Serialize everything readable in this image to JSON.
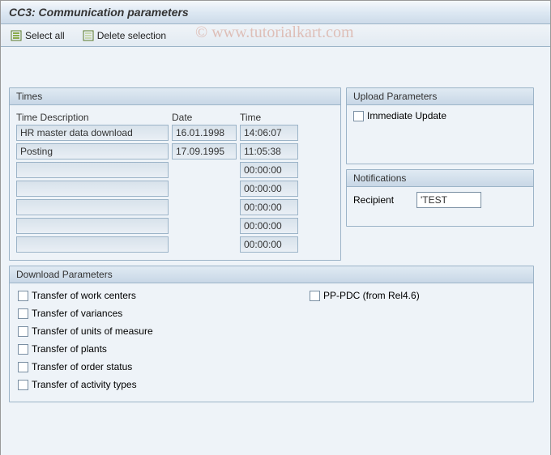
{
  "title": "CC3: Communication parameters",
  "toolbar": {
    "select_all": "Select all",
    "delete_selection": "Delete selection"
  },
  "watermark": "© www.tutorialkart.com",
  "times": {
    "title": "Times",
    "headers": {
      "desc": "Time Description",
      "date": "Date",
      "time": "Time"
    },
    "rows": [
      {
        "desc": "HR master data download",
        "date": "16.01.1998",
        "time": "14:06:07"
      },
      {
        "desc": "Posting",
        "date": "17.09.1995",
        "time": "11:05:38"
      },
      {
        "desc": "",
        "date": "",
        "time": "00:00:00"
      },
      {
        "desc": "",
        "date": "",
        "time": "00:00:00"
      },
      {
        "desc": "",
        "date": "",
        "time": "00:00:00"
      },
      {
        "desc": "",
        "date": "",
        "time": "00:00:00"
      },
      {
        "desc": "",
        "date": "",
        "time": "00:00:00"
      }
    ]
  },
  "upload": {
    "title": "Upload Parameters",
    "immediate_update": "Immediate Update"
  },
  "notifications": {
    "title": "Notifications",
    "recipient_label": "Recipient",
    "recipient_value": "'TEST"
  },
  "download": {
    "title": "Download Parameters",
    "left": [
      "Transfer of work centers",
      "Transfer of variances",
      "Transfer of units of measure",
      "Transfer of plants",
      "Transfer of order status",
      "Transfer of activity types"
    ],
    "right": [
      "PP-PDC (from Rel4.6)"
    ]
  }
}
